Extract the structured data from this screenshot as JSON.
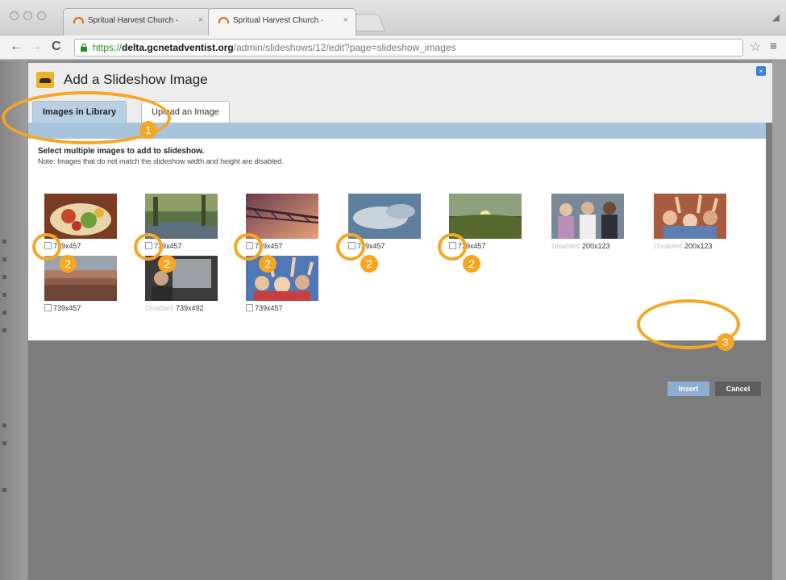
{
  "browser": {
    "tabs": [
      {
        "title": "Spritual Harvest Church - ",
        "close": "×",
        "active": false
      },
      {
        "title": "Spritual Harvest Church - ",
        "close": "×",
        "active": true
      }
    ],
    "url": {
      "protocol": "https://",
      "host": "delta.gcnetadventist.org",
      "path": "/admin/slideshows/12/edit?page=slideshow_images"
    },
    "icons": {
      "back": "←",
      "forward": "→",
      "reload": "C",
      "star": "☆",
      "menu": "≡"
    },
    "colors": {
      "accent": "#f5a623",
      "tab_blue": "#a8c4dc",
      "secure_green": "#1e8f1e"
    }
  },
  "modal": {
    "title": "Add a Slideshow Image",
    "close_glyph": "×",
    "tabs": [
      {
        "label": "Images in Library",
        "active": true
      },
      {
        "label": "Upload an Image",
        "active": false
      }
    ],
    "instruction": "Select multiple images to add to slideshow.",
    "note": "Note: Images that do not match the slideshow width and height are disabled.",
    "images": [
      {
        "size": "739x457",
        "disabled": false,
        "name": "food-plate"
      },
      {
        "size": "739x457",
        "disabled": false,
        "name": "stream-trees"
      },
      {
        "size": "739x457",
        "disabled": false,
        "name": "bridge-sunset"
      },
      {
        "size": "739x457",
        "disabled": false,
        "name": "cloudy-sky"
      },
      {
        "size": "739x457",
        "disabled": false,
        "name": "field-sunrise"
      },
      {
        "size": "200x123",
        "disabled": true,
        "disabled_label": "Disabled",
        "name": "group-people"
      },
      {
        "size": "200x123",
        "disabled": true,
        "disabled_label": "Disabled",
        "name": "kids-hands"
      },
      {
        "size": "739x457",
        "disabled": false,
        "name": "stadium-crowd"
      },
      {
        "size": "739x492",
        "disabled": true,
        "disabled_label": "Disabled",
        "name": "window-view"
      },
      {
        "size": "739x457",
        "disabled": false,
        "name": "kids-raising-hands"
      }
    ],
    "buttons": {
      "insert": "Insert",
      "cancel": "Cancel"
    }
  },
  "annotations": {
    "one": "1",
    "two": "2",
    "three": "3"
  }
}
